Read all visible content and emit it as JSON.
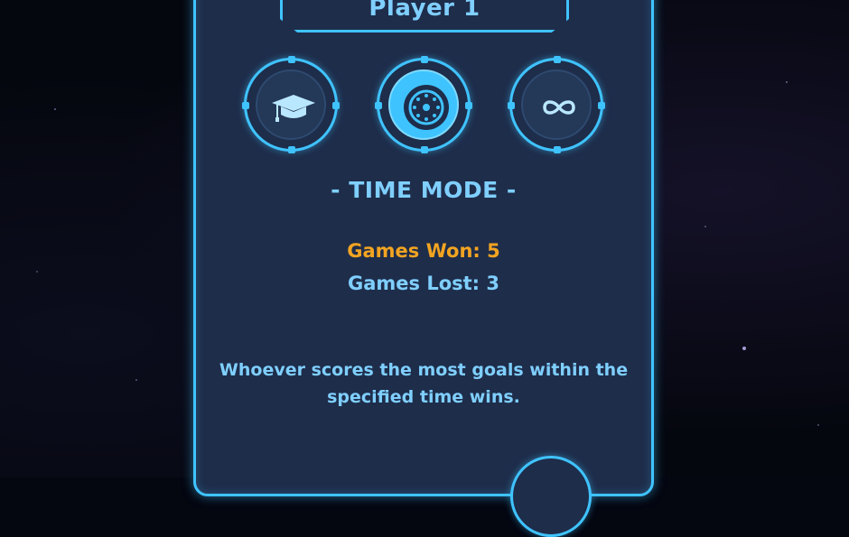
{
  "header": {
    "player_name": "Player 1"
  },
  "modes": [
    {
      "name": "training",
      "icon": "graduation-cap-icon",
      "active": false
    },
    {
      "name": "time",
      "icon": "wheel-icon",
      "active": true
    },
    {
      "name": "infinite",
      "icon": "infinity-icon",
      "active": false
    }
  ],
  "selected_mode": {
    "title": "- TIME MODE -",
    "games_won": "Games Won: 5",
    "games_lost": "Games Lost: 3",
    "description": "Whoever scores the most goals within the specified time wins."
  },
  "colors": {
    "accent": "#3fc3ff",
    "panel": "#1e2d4a",
    "highlight": "#f2a421",
    "text": "#7fcfff"
  }
}
